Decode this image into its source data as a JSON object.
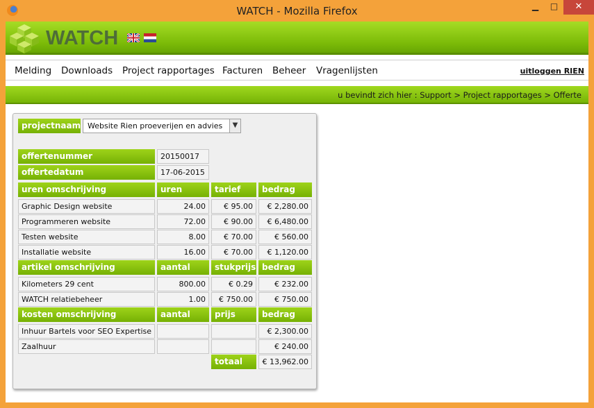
{
  "window": {
    "title": "WATCH - Mozilla Firefox",
    "minimize": "▁",
    "maximize": "□",
    "close": "✕"
  },
  "header": {
    "logo_text": "WATCH",
    "flags": [
      "uk-flag",
      "nl-flag"
    ]
  },
  "menu": {
    "items": [
      "Melding",
      "Downloads",
      "Project rapportages",
      "Facturen",
      "Beheer",
      "Vragenlijsten"
    ],
    "logout": "uitloggen RIEN"
  },
  "breadcrumb": "u bevindt zich hier : Support > Project rapportages > Offerte",
  "form": {
    "projectnaam_label": "projectnaam",
    "projectnaam_value": "Website Rien proeverijen en advies",
    "offertenummer_label": "offertenummer",
    "offertenummer_value": "20150017",
    "offertedatum_label": "offertedatum",
    "offertedatum_value": "17-06-2015"
  },
  "uren": {
    "headers": [
      "uren omschrijving",
      "uren",
      "tarief",
      "bedrag"
    ],
    "rows": [
      [
        "Graphic Design website",
        "24.00",
        "€ 95.00",
        "€ 2,280.00"
      ],
      [
        "Programmeren website",
        "72.00",
        "€ 90.00",
        "€ 6,480.00"
      ],
      [
        "Testen website",
        "8.00",
        "€ 70.00",
        "€ 560.00"
      ],
      [
        "Installatie website",
        "16.00",
        "€ 70.00",
        "€ 1,120.00"
      ]
    ]
  },
  "artikel": {
    "headers": [
      "artikel omschrijving",
      "aantal",
      "stukprijs",
      "bedrag"
    ],
    "rows": [
      [
        "Kilometers 29 cent",
        "800.00",
        "€ 0.29",
        "€ 232.00"
      ],
      [
        "WATCH relatiebeheer",
        "1.00",
        "€ 750.00",
        "€ 750.00"
      ]
    ]
  },
  "kosten": {
    "headers": [
      "kosten omschrijving",
      "aantal",
      "prijs",
      "bedrag"
    ],
    "rows": [
      [
        "Inhuur Bartels voor SEO Expertise",
        "",
        "",
        "€ 2,300.00"
      ],
      [
        "Zaalhuur",
        "",
        "",
        "€ 240.00"
      ]
    ]
  },
  "totaal": {
    "label": "totaal",
    "value": "€ 13,962.00"
  }
}
